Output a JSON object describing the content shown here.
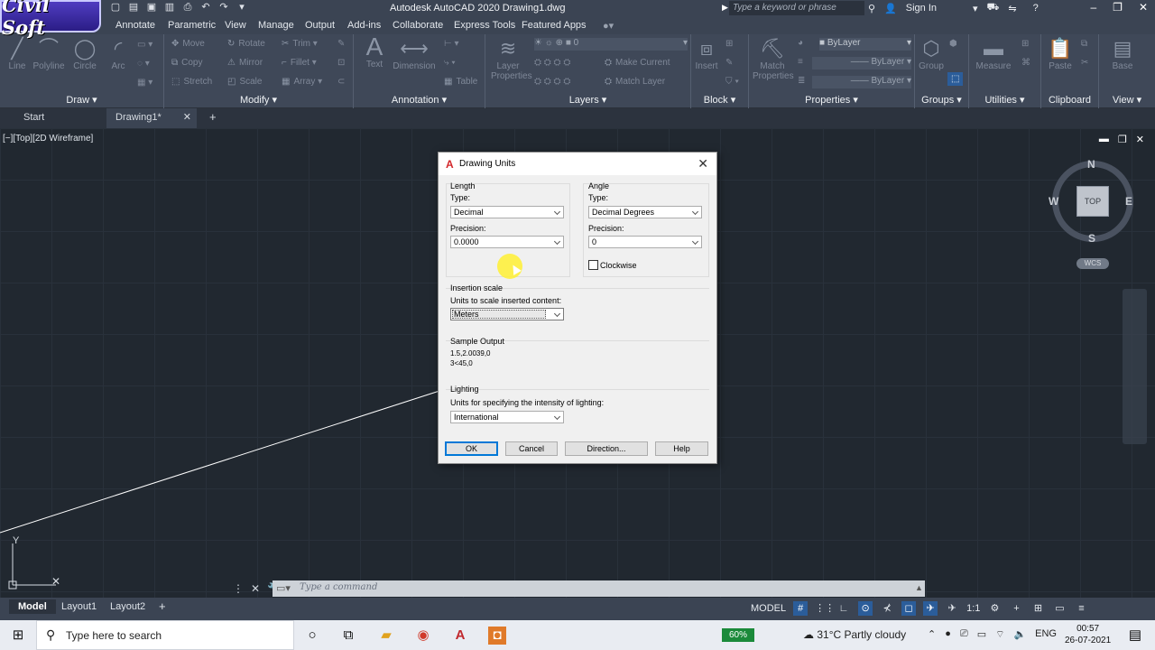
{
  "logo": "Civil Soft",
  "app": {
    "title": "Autodesk AutoCAD 2020  Drawing1.dwg",
    "search_placeholder": "Type a keyword or phrase",
    "sign_in": "Sign In"
  },
  "ribbon_tabs": [
    "Annotate",
    "Parametric",
    "View",
    "Manage",
    "Output",
    "Add-ins",
    "Collaborate",
    "Express Tools",
    "Featured Apps"
  ],
  "ribbon": {
    "draw": {
      "title": "Draw",
      "tools": [
        "Line",
        "Polyline",
        "Circle",
        "Arc"
      ]
    },
    "modify": {
      "title": "Modify",
      "tools": [
        "Move",
        "Rotate",
        "Trim",
        "Copy",
        "Mirror",
        "Fillet",
        "Stretch",
        "Scale",
        "Array"
      ]
    },
    "annotation": {
      "title": "Annotation",
      "tools": [
        "Text",
        "Dimension",
        "Table"
      ]
    },
    "layers": {
      "title": "Layers",
      "layer_properties": "Layer Properties",
      "current_layer": "0",
      "make_current": "Make Current",
      "match_layer": "Match Layer"
    },
    "block": {
      "title": "Block",
      "insert": "Insert"
    },
    "properties": {
      "title": "Properties",
      "match": "Match Properties",
      "color": "ByLayer",
      "linetype": "ByLayer",
      "lineweight": "ByLayer"
    },
    "groups": {
      "title": "Groups",
      "group": "Group"
    },
    "utilities": {
      "title": "Utilities",
      "measure": "Measure"
    },
    "clipboard": {
      "title": "Clipboard",
      "paste": "Paste"
    },
    "view": {
      "title": "View",
      "base": "Base"
    }
  },
  "doc_tabs": {
    "start": "Start",
    "active": "Drawing1*"
  },
  "viewport": {
    "label": "[−][Top][2D Wireframe]",
    "compass": {
      "n": "N",
      "s": "S",
      "e": "E",
      "w": "W",
      "face": "TOP",
      "wcs": "WCS"
    }
  },
  "dialog": {
    "title": "Drawing Units",
    "length": {
      "heading": "Length",
      "type_label": "Type:",
      "type_value": "Decimal",
      "precision_label": "Precision:",
      "precision_value": "0.0000"
    },
    "angle": {
      "heading": "Angle",
      "type_label": "Type:",
      "type_value": "Decimal Degrees",
      "precision_label": "Precision:",
      "precision_value": "0",
      "clockwise": "Clockwise",
      "clockwise_checked": false
    },
    "insertion": {
      "heading": "Insertion scale",
      "label": "Units to scale inserted content:",
      "value": "Meters"
    },
    "sample": {
      "heading": "Sample Output",
      "line1": "1.5,2.0039,0",
      "line2": "3<45,0"
    },
    "lighting": {
      "heading": "Lighting",
      "label": "Units for specifying the intensity of lighting:",
      "value": "International"
    },
    "buttons": {
      "ok": "OK",
      "cancel": "Cancel",
      "direction": "Direction...",
      "help": "Help"
    }
  },
  "command": {
    "placeholder": "Type a command"
  },
  "layout_tabs": [
    "Model",
    "Layout1",
    "Layout2"
  ],
  "status": {
    "space": "MODEL",
    "scale": "1:1"
  },
  "taskbar": {
    "search": "Type here to search",
    "battery": "60%",
    "weather": "31°C  Partly cloudy",
    "lang": "ENG",
    "time": "00:57",
    "date": "26-07-2021"
  }
}
